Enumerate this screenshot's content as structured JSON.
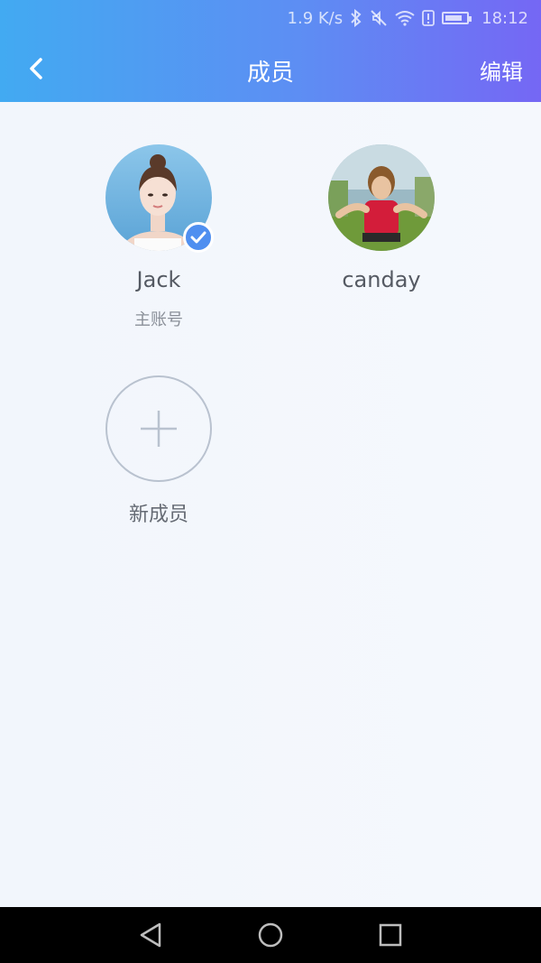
{
  "status_bar": {
    "speed": "1.9 K/s",
    "time": "18:12",
    "icons": [
      "bluetooth-icon",
      "mute-icon",
      "wifi-icon",
      "sim-alert-icon",
      "battery-icon"
    ]
  },
  "header": {
    "title": "成员",
    "edit_label": "编辑",
    "back_icon": "chevron-left-icon",
    "gradient": [
      "#42aaf2",
      "#7567f4"
    ]
  },
  "members": [
    {
      "name": "Jack",
      "role": "主账号",
      "selected": true,
      "avatar": "avatar-photo"
    },
    {
      "name": "canday",
      "role": "",
      "selected": false,
      "avatar": "avatar-photo"
    }
  ],
  "add_member": {
    "label": "新成员",
    "icon": "plus-icon"
  },
  "system_nav": {
    "buttons": [
      "back-triangle-icon",
      "home-circle-icon",
      "recents-square-icon"
    ]
  },
  "colors": {
    "accent": "#4f8ff0",
    "background": "#f3f7fd"
  }
}
